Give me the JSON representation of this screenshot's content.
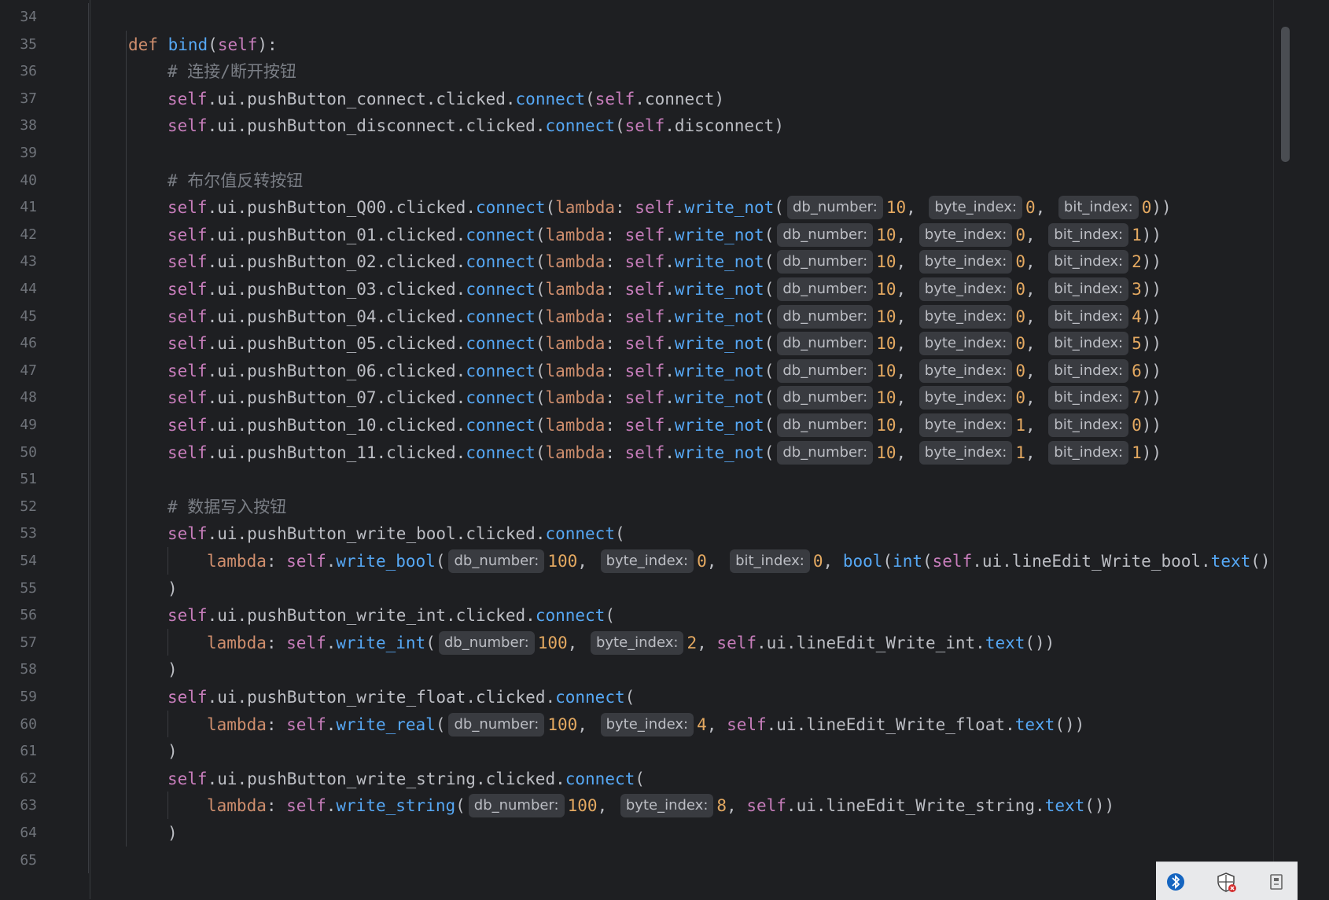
{
  "gutter": {
    "line_numbers": [
      "34",
      "35",
      "36",
      "37",
      "38",
      "39",
      "40",
      "41",
      "42",
      "43",
      "44",
      "45",
      "46",
      "47",
      "48",
      "49",
      "50",
      "51",
      "52",
      "53",
      "54",
      "55",
      "56",
      "57",
      "58",
      "59",
      "60",
      "61",
      "62",
      "63",
      "64",
      "65"
    ]
  },
  "code": {
    "def_kw": "def",
    "def_name": "bind",
    "def_self": "self",
    "comment_connect": "# 连接/断开按钮",
    "comment_bool": "# 布尔值反转按钮",
    "comment_write": "# 数据写入按钮",
    "connect_button": "pushButton_connect",
    "connect_method": "connect",
    "disconnect_button": "pushButton_disconnect",
    "disconnect_method": "disconnect",
    "hint_db": "db_number:",
    "hint_byte": "byte_index:",
    "hint_bit": "bit_index:",
    "bool_rows": [
      {
        "button": "pushButton_Q00",
        "db": "10",
        "byte": "0",
        "bit": "0"
      },
      {
        "button": "pushButton_01",
        "db": "10",
        "byte": "0",
        "bit": "1"
      },
      {
        "button": "pushButton_02",
        "db": "10",
        "byte": "0",
        "bit": "2"
      },
      {
        "button": "pushButton_03",
        "db": "10",
        "byte": "0",
        "bit": "3"
      },
      {
        "button": "pushButton_04",
        "db": "10",
        "byte": "0",
        "bit": "4"
      },
      {
        "button": "pushButton_05",
        "db": "10",
        "byte": "0",
        "bit": "5"
      },
      {
        "button": "pushButton_06",
        "db": "10",
        "byte": "0",
        "bit": "6"
      },
      {
        "button": "pushButton_07",
        "db": "10",
        "byte": "0",
        "bit": "7"
      },
      {
        "button": "pushButton_10",
        "db": "10",
        "byte": "1",
        "bit": "0"
      },
      {
        "button": "pushButton_11",
        "db": "10",
        "byte": "1",
        "bit": "1"
      }
    ],
    "write_bool": {
      "button": "pushButton_write_bool",
      "method": "write_bool",
      "db": "100",
      "byte": "0",
      "bit": "0",
      "edit": "lineEdit_Write_bool"
    },
    "write_int": {
      "button": "pushButton_write_int",
      "method": "write_int",
      "db": "100",
      "byte": "2",
      "edit": "lineEdit_Write_int"
    },
    "write_float": {
      "button": "pushButton_write_float",
      "method": "write_real",
      "db": "100",
      "byte": "4",
      "edit": "lineEdit_Write_float"
    },
    "write_string": {
      "button": "pushButton_write_string",
      "method": "write_string",
      "db": "100",
      "byte": "8",
      "edit": "lineEdit_Write_string"
    }
  },
  "tray": {
    "icons": [
      "bluetooth-icon",
      "security-shield-icon",
      "usb-device-icon"
    ]
  },
  "colors": {
    "background": "#1e1f22",
    "keyword": "#cf8e6d",
    "self": "#c77dbb",
    "function": "#56a8f5",
    "number": "#e4a961",
    "comment": "#7a7e85",
    "hint_bg": "#393b40"
  }
}
